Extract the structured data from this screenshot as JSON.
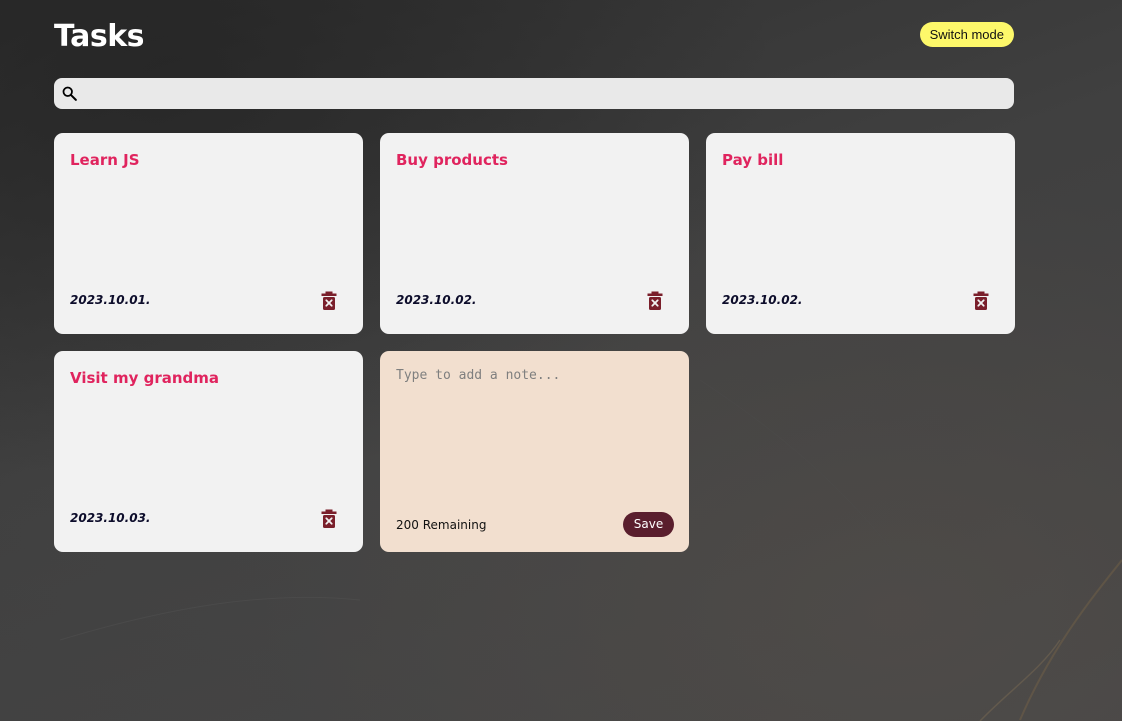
{
  "header": {
    "title": "Tasks",
    "mode_button_label": "Switch mode",
    "mode_button_color": "#fdf86a"
  },
  "search": {
    "icon": "search-icon",
    "placeholder": "",
    "value": ""
  },
  "notes": [
    {
      "title": "Learn JS",
      "date": "2023.10.01.",
      "delete_icon": "trash-icon"
    },
    {
      "title": "Buy products",
      "date": "2023.10.02.",
      "delete_icon": "trash-icon"
    },
    {
      "title": "Pay bill",
      "date": "2023.10.02.",
      "delete_icon": "trash-icon"
    },
    {
      "title": "Visit my grandma",
      "date": "2023.10.03.",
      "delete_icon": "trash-icon"
    }
  ],
  "new_note": {
    "placeholder": "Type to add a note...",
    "value": "",
    "remaining_text": "200 Remaining",
    "save_label": "Save"
  },
  "colors": {
    "note_title": "#e0245e",
    "note_background": "#f2f2f2",
    "new_note_background": "#f2dfcf",
    "save_button": "#5a1e2d",
    "delete_icon": "#7a1f2b"
  }
}
